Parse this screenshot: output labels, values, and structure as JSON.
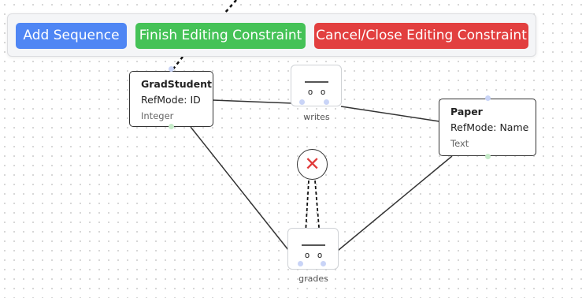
{
  "toolbar": {
    "add_sequence": "Add Sequence",
    "finish_editing": "Finish Editing Constraint",
    "cancel_editing": "Cancel/Close Editing Constraint"
  },
  "entities": {
    "grad_student": {
      "name": "GradStudent",
      "refmode": "RefMode: ID",
      "datatype": "Integer"
    },
    "paper": {
      "name": "Paper",
      "refmode": "RefMode: Name",
      "datatype": "Text"
    }
  },
  "facts": {
    "writes": {
      "label": "writes",
      "role_glyph": "o"
    },
    "grades": {
      "label": "grades",
      "role_glyph": "o"
    }
  },
  "constraint": {
    "icon": "x-icon",
    "glyph": "✕"
  },
  "colors": {
    "add_button": "#4f86f4",
    "finish_button": "#45c257",
    "cancel_button": "#e23f3f",
    "constraint_icon": "#e03a3a"
  }
}
